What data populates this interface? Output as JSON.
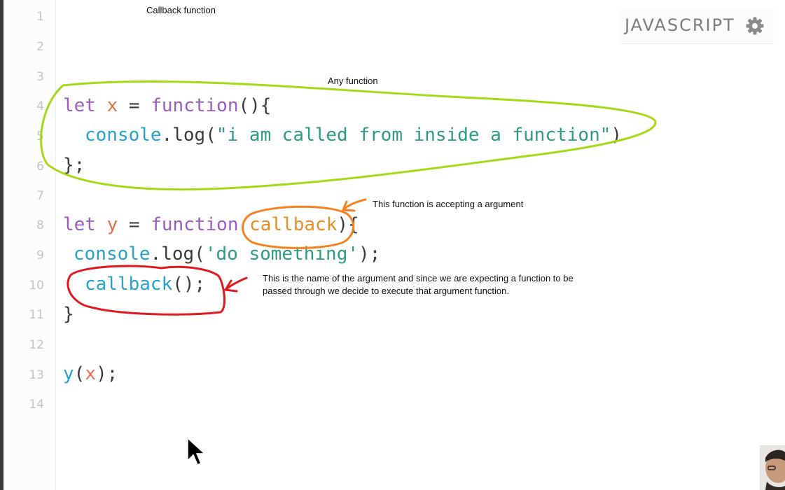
{
  "editor": {
    "language": "JAVASCRIPT",
    "line_numbers": [
      "1",
      "2",
      "3",
      "4",
      "5",
      "6",
      "7",
      "8",
      "9",
      "10",
      "11",
      "12",
      "13",
      "14"
    ],
    "lines": {
      "l4": {
        "kw": "let",
        "var": "x",
        "eq": " = ",
        "kw2": "function",
        "rest": "(){"
      },
      "l5": {
        "obj": "console",
        "dot": ".log(",
        "str": "\"i am called from inside a function\"",
        "end": ")"
      },
      "l6": {
        "text": "};"
      },
      "l8": {
        "kw": "let",
        "var": "y",
        "eq": " = ",
        "kw2": "function",
        "open": " ",
        "param": "callback",
        "rest": "){"
      },
      "l9": {
        "obj": "console",
        "dot": ".log(",
        "str": "'do something'",
        "end": ");"
      },
      "l10": {
        "fn": "callback",
        "rest": "();"
      },
      "l11": {
        "text": "}"
      },
      "l13": {
        "fn": "y",
        "open": "(",
        "var": "x",
        "rest": ");"
      }
    }
  },
  "annotations": {
    "title": "Callback function",
    "any_function": "Any function",
    "accepting": "This function is accepting a argument",
    "explanation": "This is the name of the argument and since we are expecting a function to be\npassed through we decide to execute that argument function."
  },
  "colors": {
    "keyword": "#a05bc3",
    "variable": "#e2724f",
    "call": "#26a3cf",
    "string": "#2e9c82",
    "green_marker": "#a4d916",
    "orange_marker": "#f58220",
    "red_marker": "#e0191f"
  },
  "icons": {
    "settings": "gear-icon",
    "pointer": "mouse-cursor-icon"
  }
}
